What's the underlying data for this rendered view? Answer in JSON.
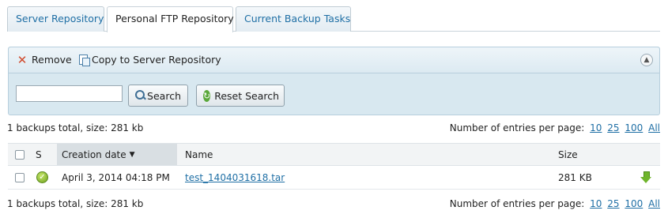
{
  "tabs": [
    {
      "label": "Server Repository",
      "active": false
    },
    {
      "label": "Personal FTP Repository",
      "active": true
    },
    {
      "label": "Current Backup Tasks",
      "active": false
    }
  ],
  "toolbar": {
    "remove_label": "Remove",
    "copy_label": "Copy to Server Repository"
  },
  "search": {
    "placeholder": "",
    "value": "",
    "search_label": "Search",
    "reset_label": "Reset Search"
  },
  "summary": {
    "text": "1 backups total, size: 281 kb",
    "per_page_label": "Number of entries per page:",
    "per_page_options": [
      "10",
      "25",
      "100",
      "All"
    ]
  },
  "table": {
    "columns": {
      "status": "S",
      "creation_date": "Creation date",
      "name": "Name",
      "size": "Size"
    },
    "rows": [
      {
        "status": "ok",
        "creation_date": "April 3, 2014 04:18 PM",
        "name": "test_1404031618.tar",
        "size": "281 KB"
      }
    ]
  },
  "colors": {
    "link": "#1f6fa5",
    "panel": "#d8e8f0",
    "ok_green": "#6ea020"
  }
}
